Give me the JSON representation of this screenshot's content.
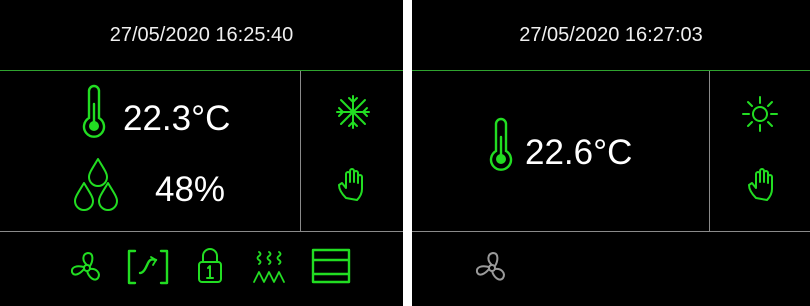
{
  "colors": {
    "accent_green": "#22dd22",
    "divider_gray": "#8a8a8a",
    "inactive_gray": "#9a9a9a",
    "background": "#000000"
  },
  "panels": [
    {
      "timestamp": "27/05/2020 16:25:40",
      "temperature": "22.3°C",
      "humidity": "48%",
      "mode_icon": "snowflake-icon",
      "control_icon": "hand-icon",
      "bottom_icons": [
        "fan-icon",
        "fan-speed-bracket-icon",
        "lock-icon",
        "heater-icon",
        "window-icon"
      ]
    },
    {
      "timestamp": "27/05/2020 16:27:03",
      "temperature": "22.6°C",
      "mode_icon": "sun-icon",
      "control_icon": "hand-icon",
      "bottom_icons": [
        "fan-icon"
      ]
    }
  ]
}
